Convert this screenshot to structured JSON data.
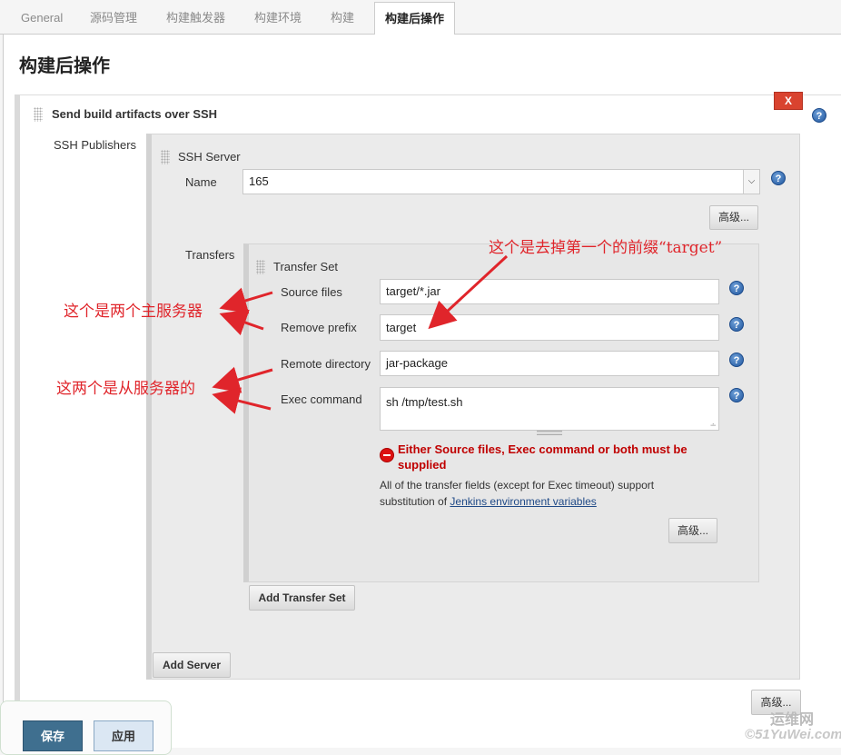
{
  "tabs": [
    "General",
    "源码管理",
    "构建触发器",
    "构建环境",
    "构建",
    "构建后操作"
  ],
  "section_title": "构建后操作",
  "step": {
    "title": "Send build artifacts over SSH",
    "delete_label": "X",
    "publishers_label": "SSH Publishers",
    "ssh_server_label": "SSH Server",
    "name_label": "Name",
    "name_value": "165",
    "advanced_label": "高级...",
    "transfers_label": "Transfers",
    "transfer_set_label": "Transfer Set",
    "source_files_label": "Source files",
    "source_files_value": "target/*.jar",
    "remove_prefix_label": "Remove prefix",
    "remove_prefix_value": "target",
    "remote_dir_label": "Remote directory",
    "remote_dir_value": "jar-package",
    "exec_command_label": "Exec command",
    "exec_command_value": "sh /tmp/test.sh",
    "error_line1": "Either Source files, Exec command or both must be",
    "error_line2": "supplied",
    "info_line1": "All of the transfer fields (except for Exec timeout) support",
    "info_prefix": "substitution of ",
    "info_link": "Jenkins environment variables",
    "transfer_advanced_label": "高级...",
    "add_transfer_set_label": "Add Transfer Set",
    "add_server_label": "Add Server",
    "bottom_advanced_label": "高级..."
  },
  "footer": {
    "save_label": "保存",
    "apply_label": "应用"
  },
  "annotations": {
    "top": "这个是去掉第一个的前缀“target”",
    "master": "这个是两个主服务器",
    "slave": "这两个是从服务器的"
  },
  "watermark": {
    "line1": "运维网",
    "line2": "51YuWei.com",
    "line2_prefix": "©"
  },
  "colors": {
    "save_button": "#3f6f8f",
    "apply_button": "#dbe7f3",
    "error": "#c00000",
    "annotation": "#e0252b",
    "delete_button": "#d9432f"
  }
}
